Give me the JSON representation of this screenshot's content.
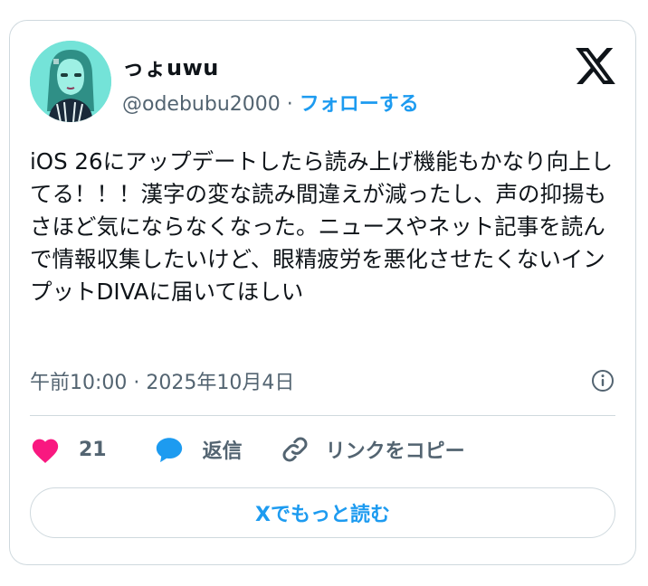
{
  "tweet": {
    "author": {
      "display_name": "っょuwu",
      "handle": "@odebubu2000",
      "separator": " · ",
      "follow_label": "フォローする",
      "avatar_icon": "avatar-illustration"
    },
    "platform_icon": "x-logo-icon",
    "text": "iOS 26にアップデートしたら読み上げ機能もかなり向上してる！！！漢字の変な読み間違えが減ったし、声の抑揚もさほど気にならなくなった。ニュースやネット記事を読んで情報収集したいけど、眼精疲労を悪化させたくないインプットDIVAに届いてほしい",
    "timestamp": "午前10:00 · 2025年10月4日",
    "info_icon": "info-icon",
    "actions": {
      "like_count": "21",
      "like_icon": "heart-icon",
      "like_color": "#f91880",
      "reply_label": "返信",
      "reply_icon": "speech-bubble-icon",
      "reply_color": "#1d9bf0",
      "copy_link_label": "リンクをコピー",
      "copy_icon": "link-icon"
    },
    "read_more_label": "Xでもっと読む",
    "accent_color": "#1d9bf0"
  }
}
